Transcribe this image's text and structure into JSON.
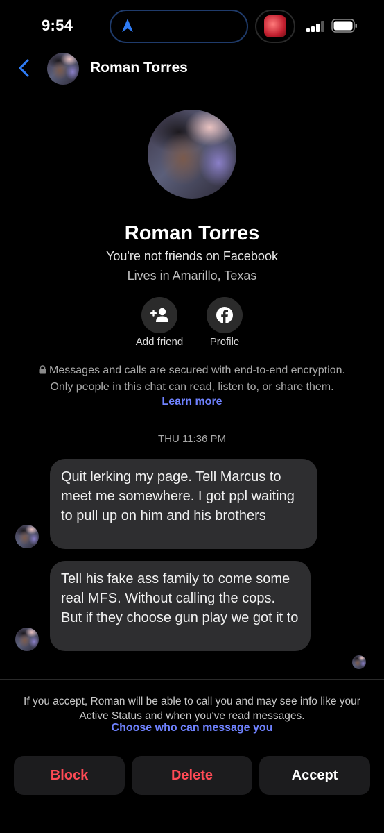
{
  "status_bar": {
    "time": "9:54"
  },
  "header": {
    "contact_name": "Roman Torres"
  },
  "profile": {
    "name": "Roman Torres",
    "friend_status": "You're not friends on Facebook",
    "location": "Lives in Amarillo, Texas",
    "add_friend_label": "Add friend",
    "profile_label": "Profile"
  },
  "encryption": {
    "line1": "Messages and calls are secured with end-to-end encryption.",
    "line2": "Only people in this chat can read, listen to, or share them.",
    "learn_more": "Learn more"
  },
  "conversation": {
    "timestamp": "THU 11:36 PM",
    "messages": [
      {
        "text": "Quit lerking my page. Tell Marcus to meet me somewhere. I got ppl waiting to pull up on him and his brothers"
      },
      {
        "text": "Tell his fake ass family to come some real MFS. Without calling the cops. But if they choose gun play we got it to"
      }
    ]
  },
  "request": {
    "info": "If you accept, Roman will be able to call you and may see info like your Active Status and when you've read messages.",
    "choose_link": "Choose who can message you",
    "block_label": "Block",
    "delete_label": "Delete",
    "accept_label": "Accept"
  },
  "colors": {
    "background": "#000000",
    "bubble": "#2e2e30",
    "link": "#6f82ff",
    "destructive": "#ff4a55",
    "back_arrow": "#2f7cf6"
  }
}
